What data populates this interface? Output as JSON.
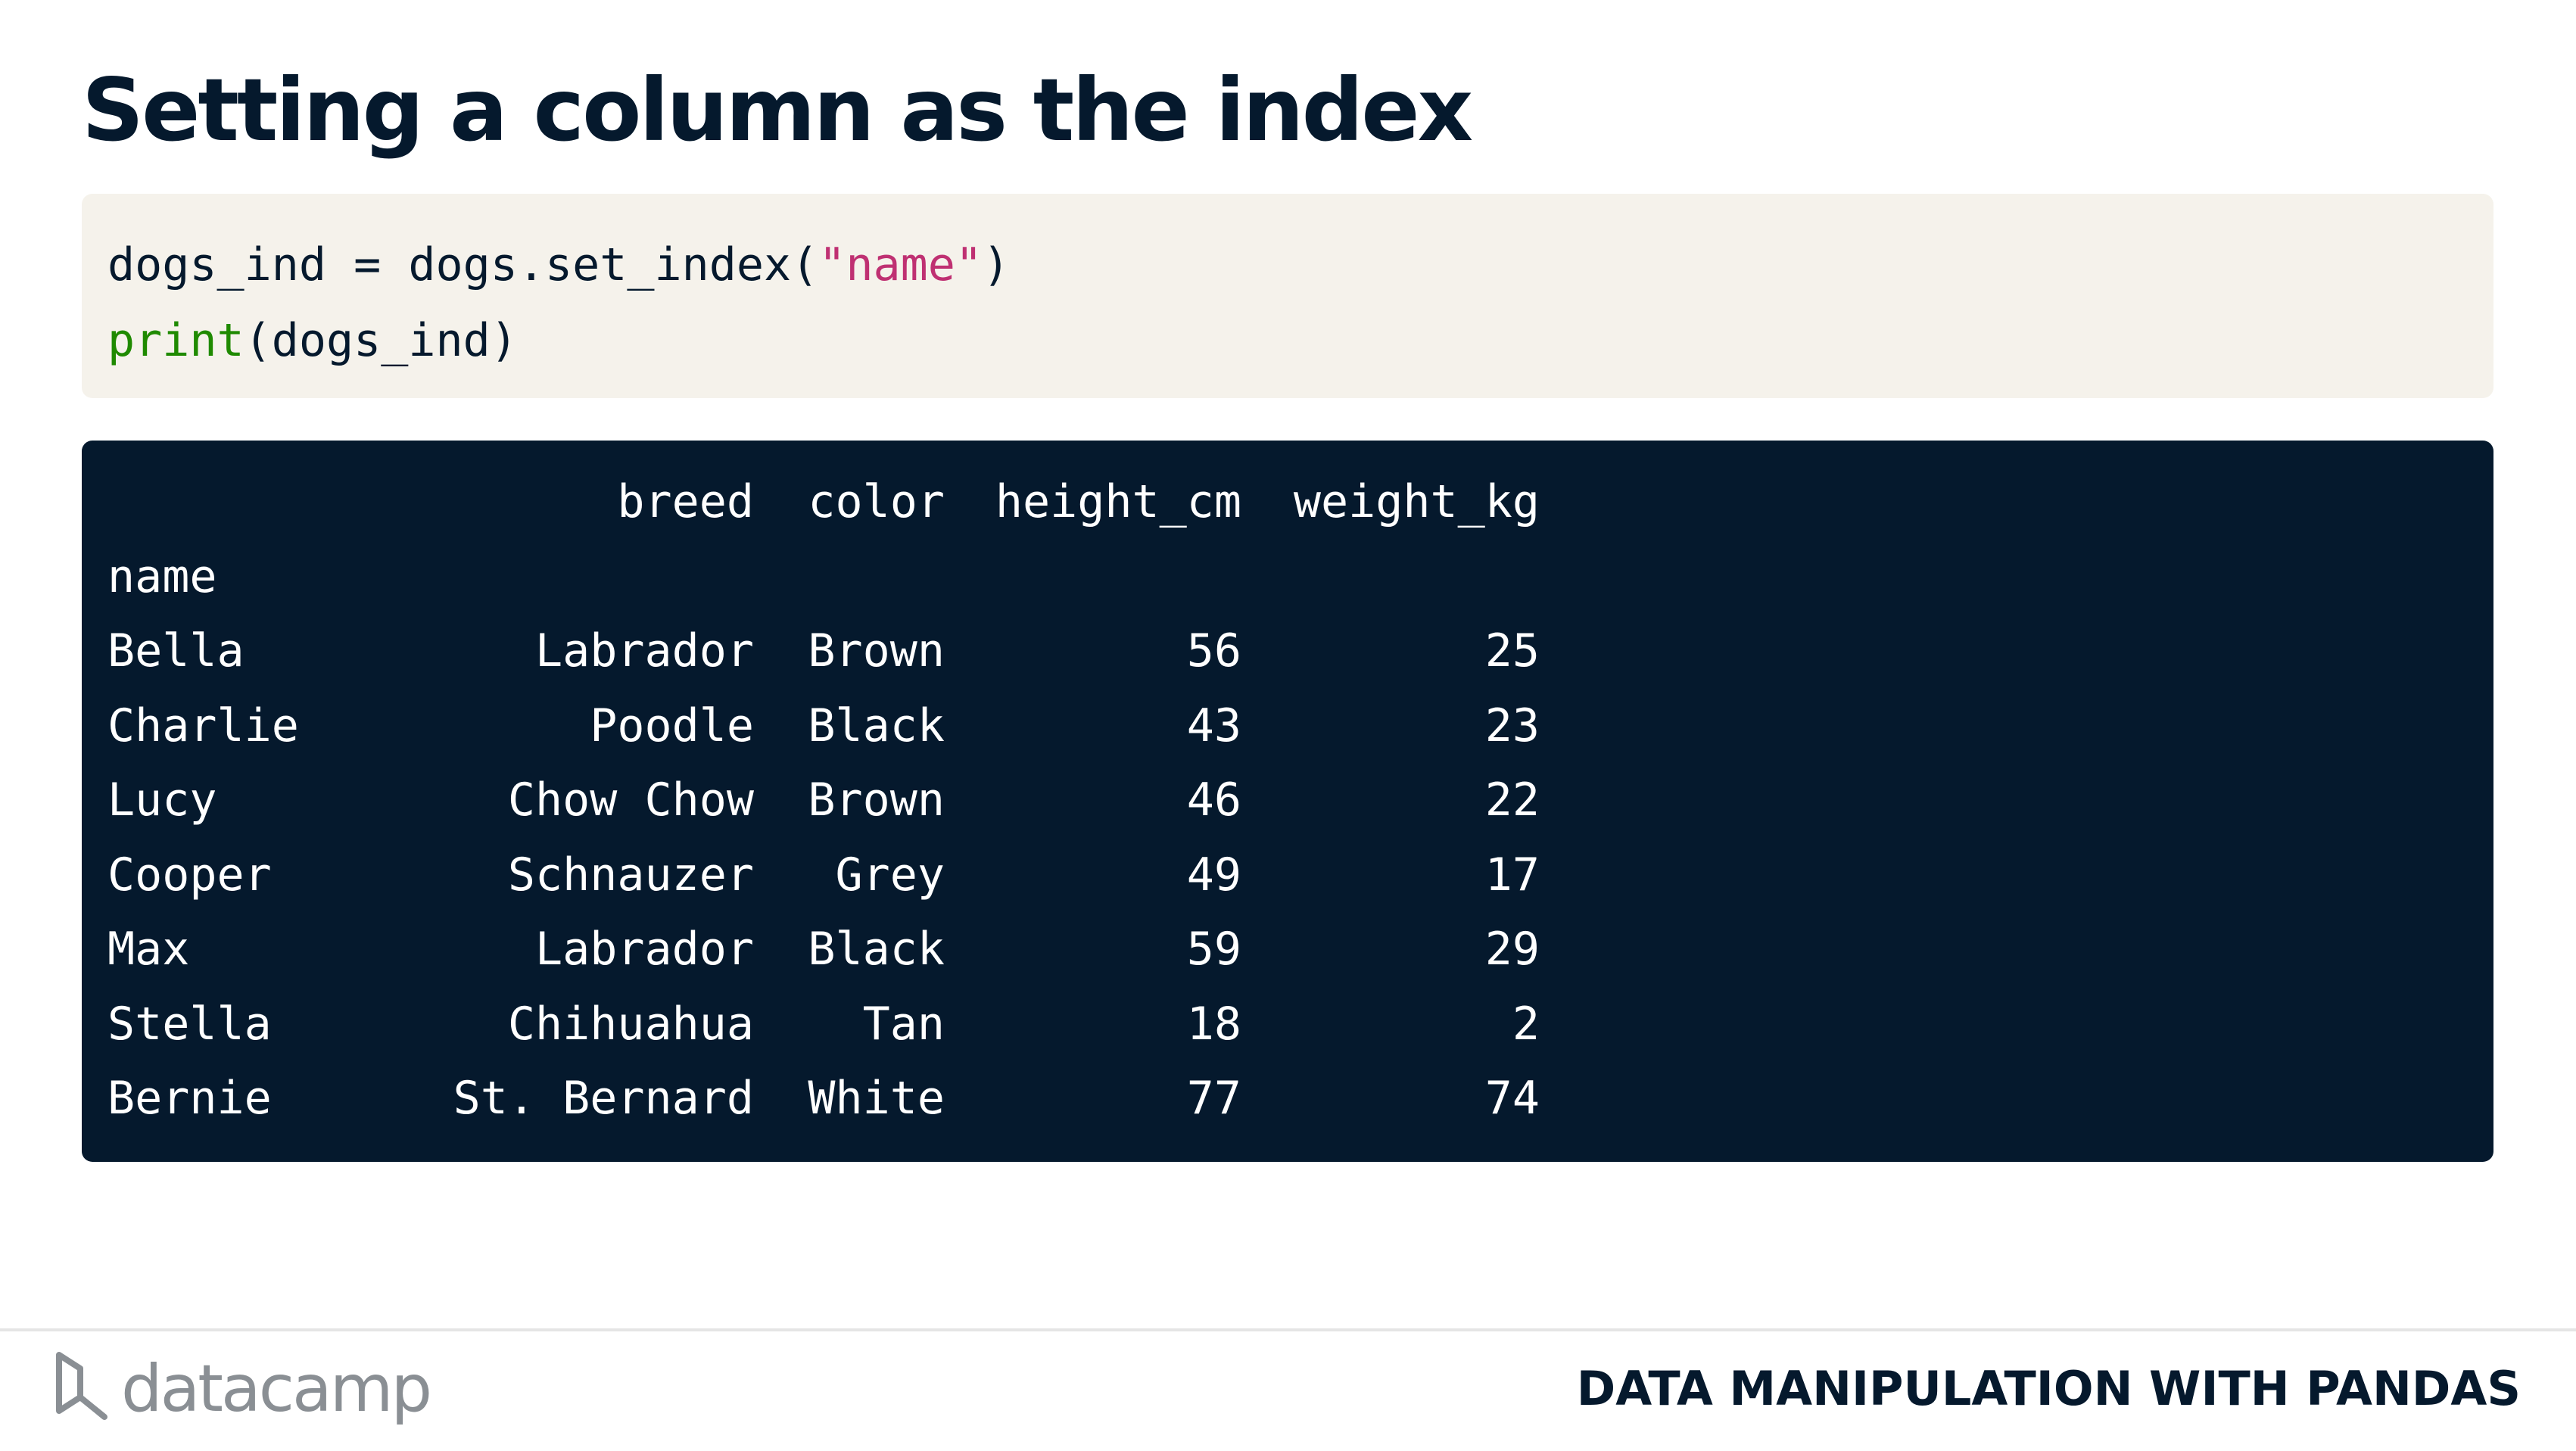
{
  "slide": {
    "title": "Setting a column as the index"
  },
  "code": {
    "line1": {
      "pre": "dogs_ind = dogs.set_index(",
      "string": "\"name\"",
      "post": ")"
    },
    "line2": {
      "fn": "print",
      "rest": "(dogs_ind)"
    }
  },
  "output": {
    "columns": [
      "breed",
      "color",
      "height_cm",
      "weight_kg"
    ],
    "index_name": "name",
    "rows": [
      {
        "name": "Bella",
        "breed": "Labrador",
        "color": "Brown",
        "height_cm": "56",
        "weight_kg": "25"
      },
      {
        "name": "Charlie",
        "breed": "Poodle",
        "color": "Black",
        "height_cm": "43",
        "weight_kg": "23"
      },
      {
        "name": "Lucy",
        "breed": "Chow Chow",
        "color": "Brown",
        "height_cm": "46",
        "weight_kg": "22"
      },
      {
        "name": "Cooper",
        "breed": "Schnauzer",
        "color": "Grey",
        "height_cm": "49",
        "weight_kg": "17"
      },
      {
        "name": "Max",
        "breed": "Labrador",
        "color": "Black",
        "height_cm": "59",
        "weight_kg": "29"
      },
      {
        "name": "Stella",
        "breed": "Chihuahua",
        "color": "Tan",
        "height_cm": "18",
        "weight_kg": "2"
      },
      {
        "name": "Bernie",
        "breed": "St. Bernard",
        "color": "White",
        "height_cm": "77",
        "weight_kg": "74"
      }
    ]
  },
  "footer": {
    "brand": "datacamp",
    "course": "DATA MANIPULATION WITH PANDAS",
    "logo_icon": "datacamp-logo-icon"
  },
  "colors": {
    "navy": "#05192d",
    "code_bg": "#f5f2eb",
    "string": "#bf3072",
    "function": "#1f8a00",
    "logo_gray": "#8a8f94"
  }
}
